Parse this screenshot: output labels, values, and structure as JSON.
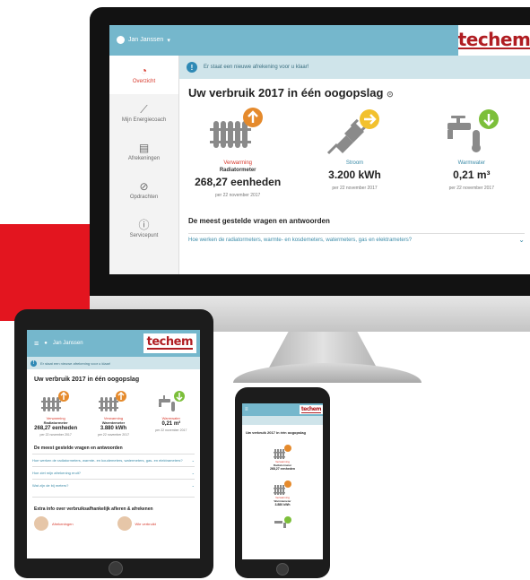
{
  "brand": {
    "logo": "techem",
    "accent": "#b01d22",
    "header_color": "#75b7cc",
    "highlight": "#e3151f"
  },
  "desktop": {
    "user_label": "Jan Janssen",
    "sidebar": [
      {
        "label": "Overzicht",
        "icon": "gauge-icon",
        "active": true
      },
      {
        "label": "Mijn Energiecoach",
        "icon": "chart-line-icon",
        "active": false
      },
      {
        "label": "Afrekeningen",
        "icon": "document-icon",
        "active": false
      },
      {
        "label": "Opdrachten",
        "icon": "paperclip-icon",
        "active": false
      },
      {
        "label": "Servicepunt",
        "icon": "info-icon",
        "active": false
      }
    ],
    "notice": "Er staat een nieuwe afrekening voor u klaar!",
    "title": "Uw verbruik 2017 in één oogopslag",
    "cards": [
      {
        "label": "Verwarming",
        "sublabel": "Radiatormeter",
        "value": "268,27 eenheden",
        "date": "per 22 november 2017",
        "icon": "radiator-icon",
        "badge": "orange"
      },
      {
        "label": "Stroom",
        "sublabel": "",
        "value": "3.200 kWh",
        "date": "per 22 november 2017",
        "icon": "plug-icon",
        "badge": "yellow"
      },
      {
        "label": "Warmwater",
        "sublabel": "",
        "value": "0,21 m³",
        "date": "per 22 november 2017",
        "icon": "tap-icon",
        "badge": "green"
      }
    ],
    "faq_title": "De meest gestelde vragen en antwoorden",
    "faq_items": [
      "Hoe werken de radiatormeters, warmte- en kosdemeters, watermeters, gas en elektrameters?"
    ]
  },
  "tablet": {
    "user_label": "Jan Janssen",
    "notice": "Er staat een nieuwe afrekening voor u klaar!",
    "title": "Uw verbruik 2017 in één oogopslag",
    "cards": [
      {
        "label": "Verwarming",
        "sublabel": "Radiatormeter",
        "value": "268,27 eenheden",
        "date": "per 22 november 2017"
      },
      {
        "label": "Verwarming",
        "sublabel": "Warmtemeter",
        "value": "3.880 kWh",
        "date": "per 22 november 2017"
      },
      {
        "label": "Warmwater",
        "sublabel": "",
        "value": "0,21 m³",
        "date": "per 22 november 2017"
      }
    ],
    "faq_title": "De meest gestelde vragen en antwoorden",
    "faq_items": [
      "Hoe werken de radiatormeters, warmte- en koudemeters, watermeters, gas- en elektrameters?",
      "Hoe ziet mijn afrekening eruit?",
      "Wat zijn de bij meters?"
    ],
    "extra_title": "Extra info over verbruiksafhankelijk afleren & afrekenen",
    "extra_items": [
      "Afrekeningen",
      "Wie verbruikt"
    ]
  },
  "phone": {
    "title": "Uw verbruik 2017 in één oogopslag",
    "cards": [
      {
        "label": "Verwarming",
        "sublabel": "Radiatormeter",
        "value": "268,27 eenheden"
      },
      {
        "label": "Verwarming",
        "sublabel": "Warmtemeter",
        "value": "3.880 kWh"
      }
    ]
  }
}
